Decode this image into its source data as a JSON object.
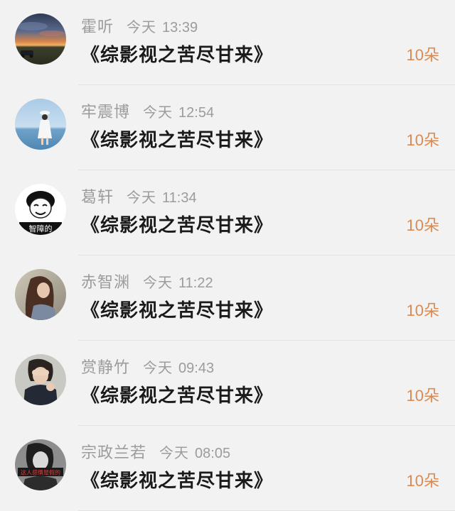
{
  "gifts": [
    {
      "name": "霍听",
      "day": "今天",
      "time": "13:39",
      "gift": "《综影视之苦尽甘来》",
      "count": "10朵",
      "avatar_icon": "sunset-landscape-avatar-icon"
    },
    {
      "name": "牢震博",
      "day": "今天",
      "time": "12:54",
      "gift": "《综影视之苦尽甘来》",
      "count": "10朵",
      "avatar_icon": "girl-by-sea-avatar-icon"
    },
    {
      "name": "葛轩",
      "day": "今天",
      "time": "11:34",
      "gift": "《综影视之苦尽甘来》",
      "count": "10朵",
      "avatar_icon": "meme-face-avatar-icon"
    },
    {
      "name": "赤智渊",
      "day": "今天",
      "time": "11:22",
      "gift": "《综影视之苦尽甘来》",
      "count": "10朵",
      "avatar_icon": "long-hair-girl-avatar-icon"
    },
    {
      "name": "赏静竹",
      "day": "今天",
      "time": "09:43",
      "gift": "《综影视之苦尽甘来》",
      "count": "10朵",
      "avatar_icon": "covered-eyes-girl-avatar-icon"
    },
    {
      "name": "宗政兰若",
      "day": "今天",
      "time": "08:05",
      "gift": "《综影视之苦尽甘来》",
      "count": "10朵",
      "avatar_icon": "mono-portrait-avatar-icon"
    }
  ],
  "meme_caption": "智障的",
  "banner_text": "这人感情是假的"
}
